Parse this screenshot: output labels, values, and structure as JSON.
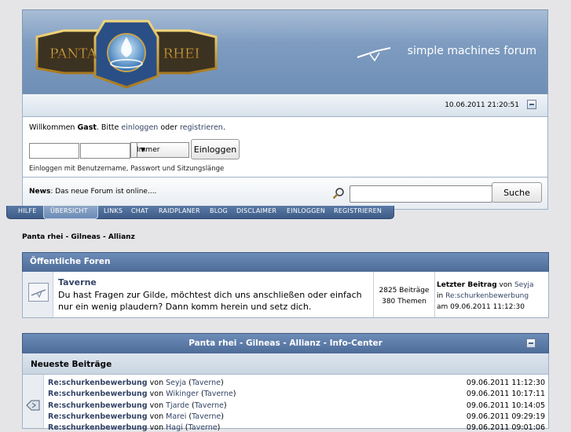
{
  "header": {
    "logo_text_left": "PANTA",
    "logo_text_right": "RHEI",
    "smf_label": "simple machines forum",
    "date": "10.06.2011 21:20:51"
  },
  "login": {
    "welcome_prefix": "Willkommen",
    "welcome_user": "Gast",
    "welcome_mid": ". Bitte",
    "login_link": "einloggen",
    "or_text": "oder",
    "register_link": "registrieren",
    "welcome_end": ".",
    "username_value": "",
    "password_value": "",
    "duration_value": "Immer",
    "login_button": "Einloggen",
    "hint": "Einloggen mit Benutzername, Passwort und Sitzungslänge"
  },
  "news": {
    "label": "News",
    "text": ": Das neue Forum ist online....",
    "search_value": "",
    "search_button": "Suche"
  },
  "menu": [
    "HILFE",
    "ÜBERSICHT",
    "LINKS",
    "CHAT",
    "RAIDPLANER",
    "BLOG",
    "DISCLAIMER",
    "EINLOGGEN",
    "REGISTRIEREN"
  ],
  "breadcrumb": "Panta rhei - Gilneas - Allianz",
  "category": {
    "title": "Öffentliche Foren"
  },
  "board": {
    "name": "Taverne",
    "description": "Du hast Fragen zur Gilde, möchtest dich uns anschließen oder einfach nur ein wenig plaudern? Dann komm herein und setz dich.",
    "posts": "2825 Beiträge",
    "topics": "380 Themen",
    "last_label": "Letzter Beitrag",
    "last_by": "von",
    "last_user": "Seyja",
    "last_in": "in",
    "last_topic": "Re:schurkenbewerbung",
    "last_am": "am",
    "last_date": "09.06.2011 11:12:30"
  },
  "info_center": {
    "title": "Panta rhei - Gilneas - Allianz - Info-Center",
    "newest_header": "Neueste Beiträge",
    "posts": [
      {
        "topic": "Re:schurkenbewerbung",
        "by": "von",
        "user": "Seyja",
        "board": "Taverne",
        "date": "09.06.2011 11:12:30"
      },
      {
        "topic": "Re:schurkenbewerbung",
        "by": "von",
        "user": "Wikinger",
        "board": "Taverne",
        "date": "09.06.2011 10:17:11"
      },
      {
        "topic": "Re:schurkenbewerbung",
        "by": "von",
        "user": "Tjarde",
        "board": "Taverne",
        "date": "09.06.2011 10:14:05"
      },
      {
        "topic": "Re:schurkenbewerbung",
        "by": "von",
        "user": "Marei",
        "board": "Taverne",
        "date": "09.06.2011 09:29:19"
      },
      {
        "topic": "Re:schurkenbewerbung",
        "by": "von",
        "user": "Hagi",
        "board": "Taverne",
        "date": "09.06.2011 09:01:06"
      }
    ]
  },
  "colors": {
    "header_blue": "#7e9cc0",
    "category_blue": "#4d6c98",
    "link": "#346"
  }
}
